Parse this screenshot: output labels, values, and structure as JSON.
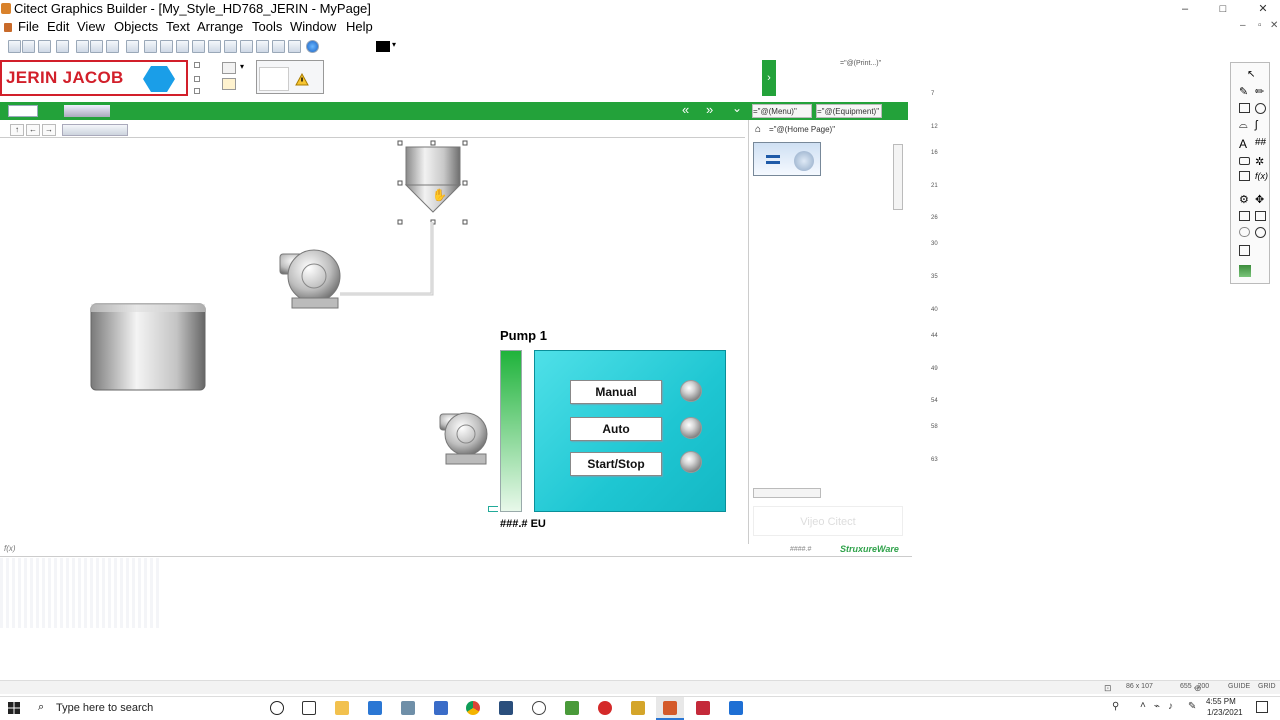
{
  "window": {
    "title": "Citect Graphics Builder - [My_Style_HD768_JERIN - MyPage]",
    "controls": {
      "minimize": "–",
      "maximize": "□",
      "close": "✕",
      "mdi_min": "–",
      "mdi_restore": "▫",
      "mdi_close": "✕"
    }
  },
  "menu": {
    "items": [
      {
        "label": "File"
      },
      {
        "label": "Edit"
      },
      {
        "label": "View"
      },
      {
        "label": "Objects"
      },
      {
        "label": "Text"
      },
      {
        "label": "Arrange"
      },
      {
        "label": "Tools"
      },
      {
        "label": "Window"
      },
      {
        "label": "Help"
      }
    ]
  },
  "header": {
    "logo_text": "JERIN JACOB",
    "green_arrow": "›",
    "nav_left": "«",
    "nav_right": "»",
    "nav_down": "⌄",
    "tab_menu": "=\"@(Menu)\"",
    "tab_equipment": "=\"@(Equipment)\"",
    "print_label": "=\"@(Print...)\"",
    "home_page": "=\"@(Home Page)\""
  },
  "panel": {
    "watermark": "Vijeo Citect",
    "footer_value": "####.#",
    "brand": "StruxureWare"
  },
  "ruler_ticks": [
    "7",
    "12",
    "16",
    "21",
    "26",
    "30",
    "35",
    "40",
    "44",
    "49",
    "54",
    "58",
    "63"
  ],
  "pump": {
    "title": "Pump 1",
    "level_value_label": "###.# EU",
    "buttons": [
      {
        "label": "Manual"
      },
      {
        "label": "Auto"
      },
      {
        "label": "Start/Stop"
      }
    ]
  },
  "status": {
    "size": "86 x 107",
    "position": "655 , 200",
    "guide": "GUIDE",
    "grid": "GRID",
    "f10": "f(x)"
  },
  "taskbar": {
    "search_placeholder": "Type here to search",
    "time": "4:55 PM",
    "date": "1/23/2021"
  },
  "colors": {
    "header_green": "#23a23a",
    "logo_red": "#d21f2a",
    "logo_blue": "#1a9ee8",
    "faceplate_cyan": "#1ec6d2",
    "level_green": "#1fb33b"
  }
}
